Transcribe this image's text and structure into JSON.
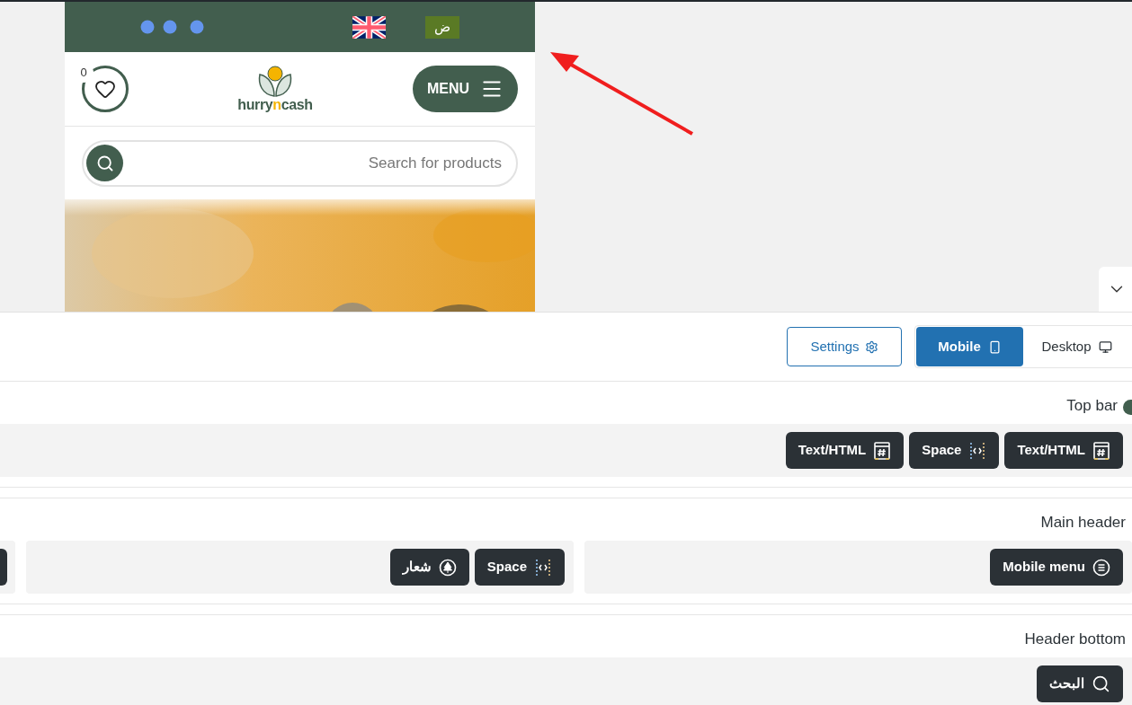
{
  "preview": {
    "top_bar": {
      "language_button": "ض"
    },
    "header": {
      "wishlist_count": "0",
      "logo": {
        "before": "hurry",
        "accent": "n",
        "after": "cash"
      },
      "menu_button": "MENU"
    },
    "search": {
      "placeholder": "Search for products"
    }
  },
  "builder": {
    "settings_button": "Settings",
    "view_tabs": [
      {
        "label": "Mobile",
        "kind": "mobile",
        "selected": true
      },
      {
        "label": "Desktop",
        "kind": "desktop",
        "selected": false
      }
    ],
    "sections": [
      {
        "title": "Top bar",
        "color": "#415e4e",
        "groups": [
          {
            "items": [
              {
                "kind": "text_html",
                "label": "Text/HTML"
              },
              {
                "kind": "space",
                "label": "Space"
              },
              {
                "kind": "text_html",
                "label": "Text/HTML"
              }
            ]
          }
        ]
      },
      {
        "title": "Main header",
        "groups": [
          {
            "items": [
              {
                "kind": "cut_off"
              }
            ]
          },
          {
            "items": [
              {
                "kind": "logo",
                "label": "شعار"
              },
              {
                "kind": "space",
                "label": "Space"
              }
            ]
          },
          {
            "items": [
              {
                "kind": "mobile_menu",
                "label": "Mobile menu"
              }
            ]
          }
        ]
      },
      {
        "title": "Header bottom",
        "groups": [
          {
            "items": [
              {
                "kind": "search",
                "label": "البحث"
              }
            ]
          }
        ]
      }
    ]
  }
}
